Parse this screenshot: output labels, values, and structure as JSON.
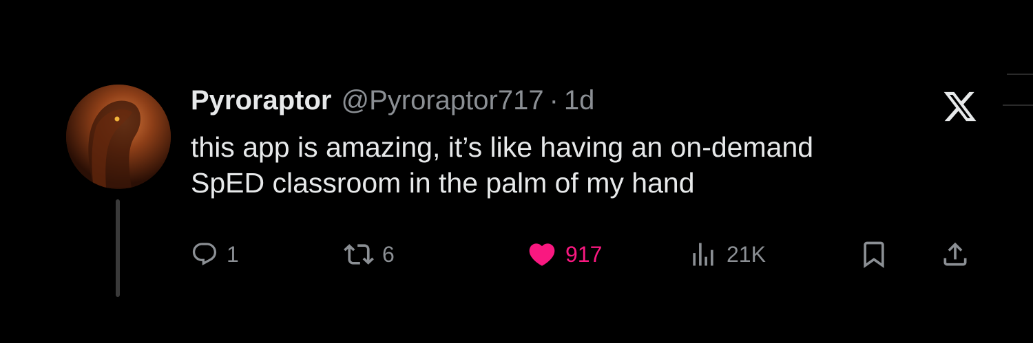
{
  "tweet": {
    "author_name": "Pyroraptor",
    "author_handle": "@Pyroraptor717",
    "separator": "·",
    "time": "1d",
    "text_lines": [
      "this app is amazing, it’s like having an on-demand",
      "SpED classroom in the palm of my hand"
    ]
  },
  "actions": {
    "replies": "1",
    "reposts": "6",
    "likes": "917",
    "views": "21K"
  },
  "icons": {
    "brand": "x-logo-icon",
    "reply": "reply-icon",
    "repost": "repost-icon",
    "like": "heart-icon",
    "views": "views-icon",
    "bookmark": "bookmark-icon",
    "share": "share-icon"
  },
  "colors": {
    "background": "#000000",
    "text": "#e7e9ea",
    "muted": "#8b8f94",
    "like_accent": "#f91880"
  }
}
